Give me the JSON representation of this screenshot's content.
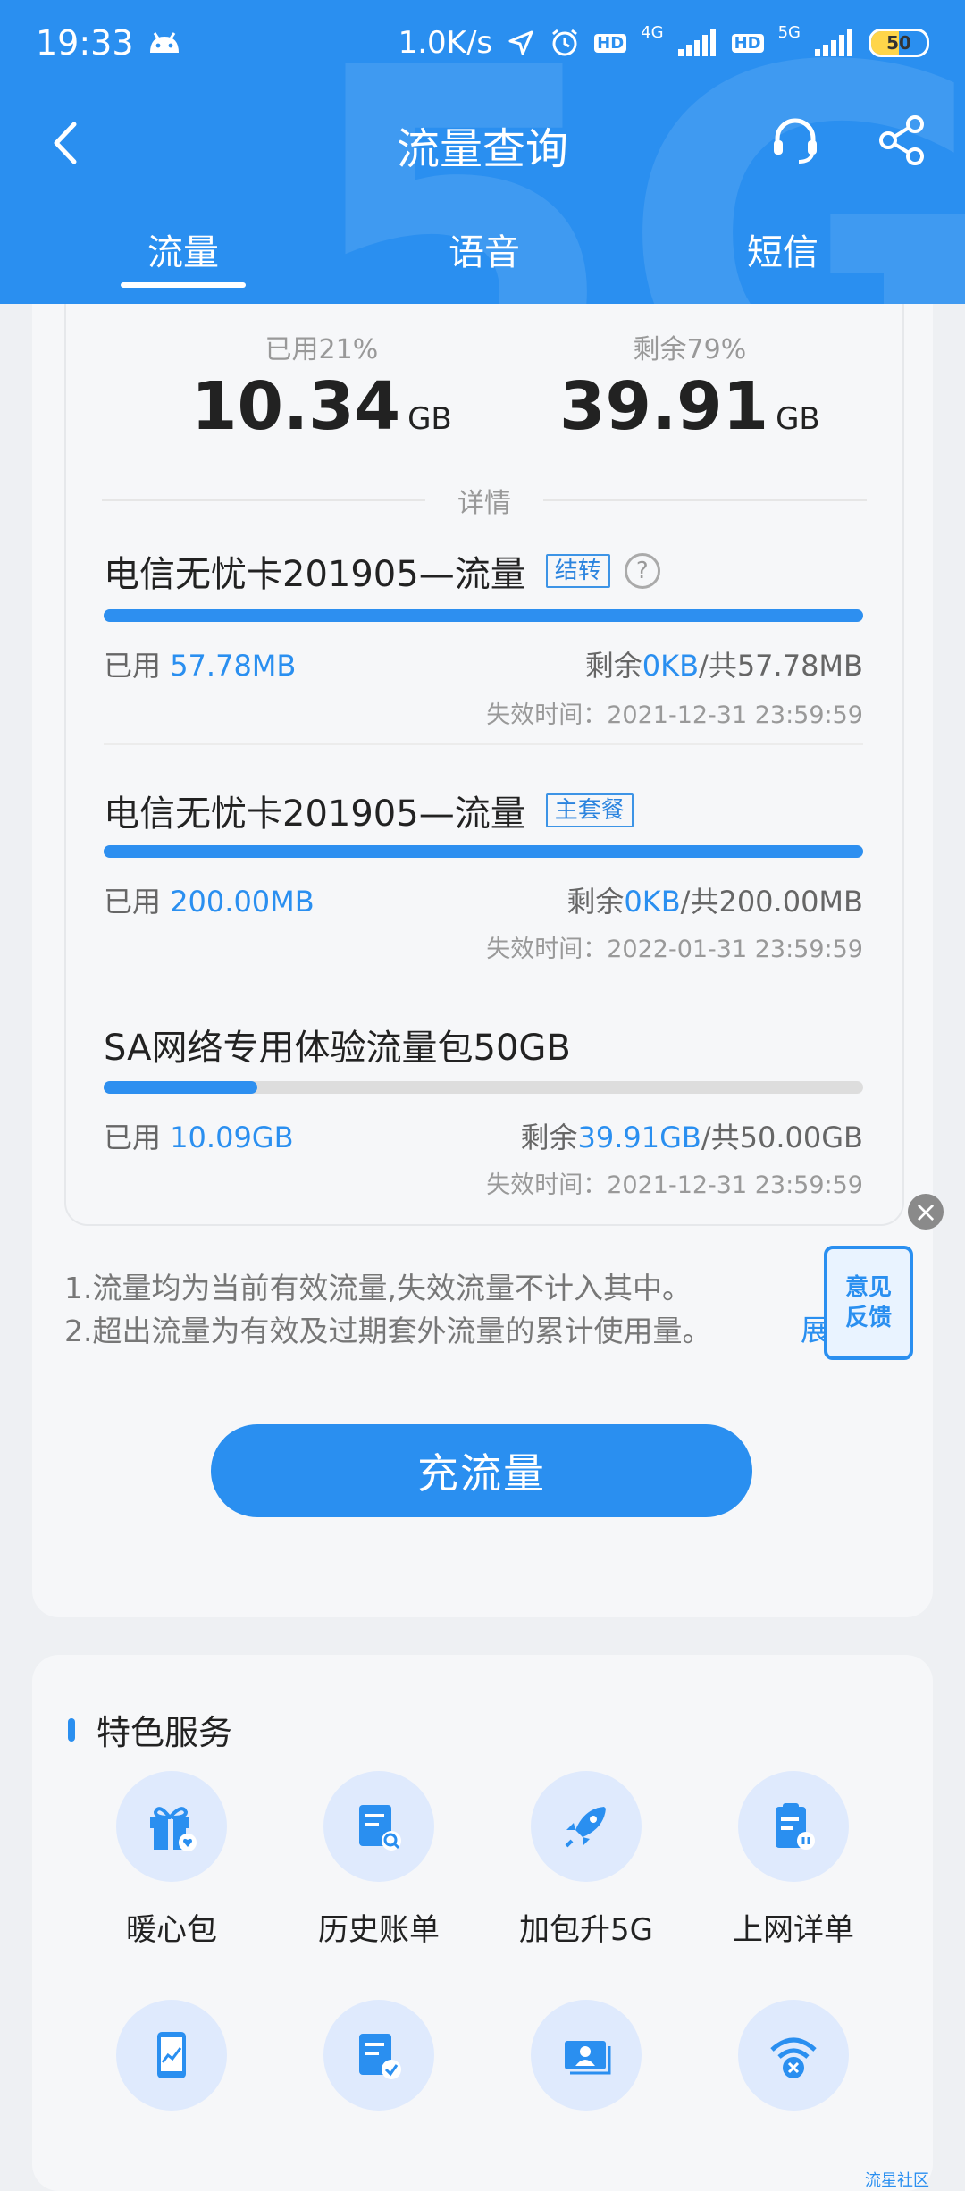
{
  "status_bar": {
    "time": "19:33",
    "net_speed": "1.0K/s",
    "sim1_type": "4G",
    "sim2_type": "5G",
    "battery": "50"
  },
  "nav": {
    "title": "流量查询"
  },
  "tabs": [
    {
      "label": "流量",
      "active": true
    },
    {
      "label": "语音",
      "active": false
    },
    {
      "label": "短信",
      "active": false
    }
  ],
  "summary": {
    "used_label": "已用21%",
    "used_value": "10.34",
    "remain_label": "剩余79%",
    "remain_value": "39.91",
    "unit": "GB",
    "detail_label": "详情"
  },
  "packages": [
    {
      "name": "电信无忧卡201905—流量",
      "tag": "结转",
      "has_help": true,
      "used_prefix": "已用",
      "used": "57.78MB",
      "remain_prefix": "剩余",
      "remain": "0KB",
      "total": "/共57.78MB",
      "expire": "失效时间：2021-12-31 23:59:59",
      "progress": 1.0
    },
    {
      "name": "电信无忧卡201905—流量",
      "tag": "主套餐",
      "has_help": false,
      "used_prefix": "已用",
      "used": "200.00MB",
      "remain_prefix": "剩余",
      "remain": "0KB",
      "total": "/共200.00MB",
      "expire": "失效时间：2022-01-31 23:59:59",
      "progress": 1.0
    },
    {
      "name": "SA网络专用体验流量包50GB",
      "tag": "",
      "has_help": false,
      "used_prefix": "已用",
      "used": "10.09GB",
      "remain_prefix": "剩余",
      "remain": "39.91GB",
      "total": "/共50.00GB",
      "expire": "失效时间：2021-12-31 23:59:59",
      "progress": 0.2018
    }
  ],
  "notes": {
    "line1": "1.流量均为当前有效流量,失效流量不计入其中。",
    "line2": "2.超出流量为有效及过期套外流量的累计使用量。",
    "expand": "展"
  },
  "feedback": {
    "line1": "意见",
    "line2": "反馈"
  },
  "recharge_label": "充流量",
  "services": {
    "title": "特色服务",
    "items": [
      {
        "label": "暖心包",
        "icon": "gift-icon"
      },
      {
        "label": "历史账单",
        "icon": "bill-search-icon"
      },
      {
        "label": "加包升5G",
        "icon": "rocket-icon"
      },
      {
        "label": "上网详单",
        "icon": "clipboard-icon"
      },
      {
        "label": "",
        "icon": "phone-chart-icon"
      },
      {
        "label": "",
        "icon": "bill-check-icon"
      },
      {
        "label": "",
        "icon": "id-card-icon"
      },
      {
        "label": "",
        "icon": "wifi-off-icon"
      }
    ]
  },
  "corner_mark": "流星社区"
}
